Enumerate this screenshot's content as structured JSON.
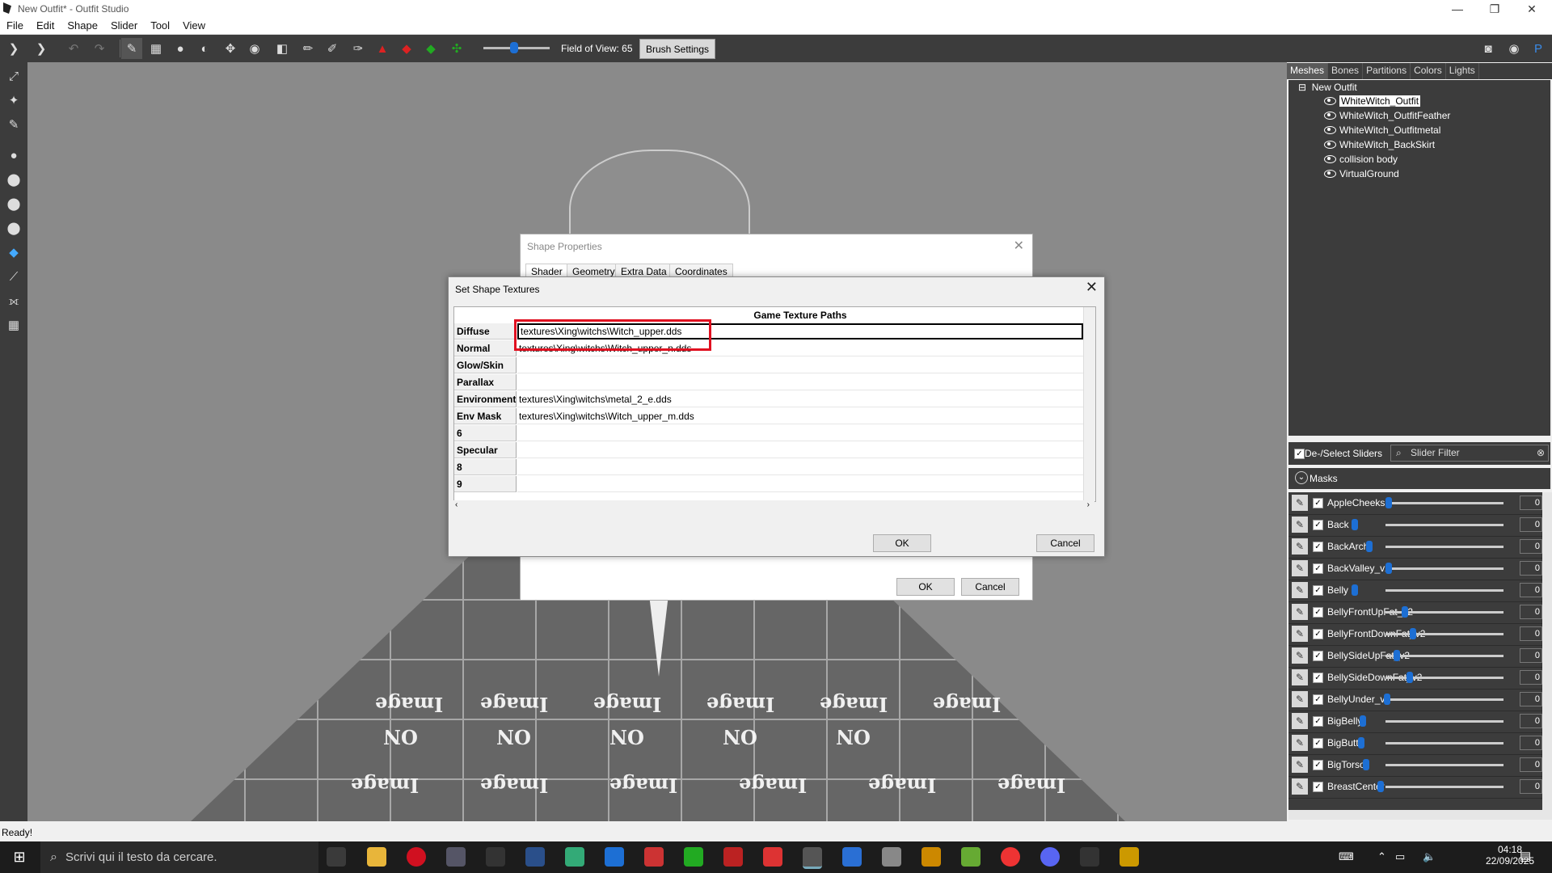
{
  "window": {
    "title": "New Outfit* - Outfit Studio",
    "minimize": "—",
    "maximize": "❐",
    "close": "✕"
  },
  "menu": [
    "File",
    "Edit",
    "Shape",
    "Slider",
    "Tool",
    "View"
  ],
  "toolbar": {
    "fov_label": "Field of View: 65",
    "brush_settings": "Brush Settings"
  },
  "right_panel": {
    "tabs": [
      "Meshes",
      "Bones",
      "Partitions",
      "Colors",
      "Lights"
    ],
    "tree_root": "New Outfit",
    "meshes": [
      "WhiteWitch_Outfit",
      "WhiteWitch_OutfitFeather",
      "WhiteWitch_Outfitmetal",
      "WhiteWitch_BackSkirt",
      "collision body",
      "VirtualGround"
    ],
    "selected_mesh": "WhiteWitch_Outfit",
    "deselect_label": "De-/Select Sliders",
    "slider_filter_placeholder": "Slider Filter",
    "masks_label": "Masks",
    "sliders": [
      {
        "name": "AppleCheeks",
        "pos": 0.0,
        "val": "0"
      },
      {
        "name": "Back",
        "pos": 0.0,
        "val": "0"
      },
      {
        "name": "BackArch",
        "pos": 0.0,
        "val": "0"
      },
      {
        "name": "BackValley_v2",
        "pos": 0.0,
        "val": "0"
      },
      {
        "name": "Belly",
        "pos": 0.0,
        "val": "0"
      },
      {
        "name": "BellyFrontUpFat_v2",
        "pos": 0.0,
        "val": "0"
      },
      {
        "name": "BellyFrontDownFat_v2",
        "pos": 0.0,
        "val": "0"
      },
      {
        "name": "BellySideUpFat_v2",
        "pos": 0.0,
        "val": "0"
      },
      {
        "name": "BellySideDownFat_v2",
        "pos": 0.0,
        "val": "0"
      },
      {
        "name": "BellyUnder_v2",
        "pos": 0.0,
        "val": "0"
      },
      {
        "name": "BigBelly",
        "pos": 0.0,
        "val": "0"
      },
      {
        "name": "BigButt",
        "pos": 0.0,
        "val": "0"
      },
      {
        "name": "BigTorso",
        "pos": 0.0,
        "val": "0"
      },
      {
        "name": "BreastCenter",
        "pos": 0.0,
        "val": "0"
      }
    ]
  },
  "status": "Ready!",
  "shape_properties": {
    "title": "Shape Properties",
    "tabs": [
      "Shader",
      "Geometry",
      "Extra Data",
      "Coordinates"
    ],
    "ok": "OK",
    "cancel": "Cancel"
  },
  "set_shape_textures": {
    "title": "Set Shape Textures",
    "column_header": "Game Texture Paths",
    "rows": [
      {
        "label": "Diffuse",
        "path": "textures\\Xing\\witchs\\Witch_upper.dds"
      },
      {
        "label": "Normal",
        "path": "textures\\Xing\\witchs\\Witch_upper_n.dds"
      },
      {
        "label": "Glow/Skin",
        "path": ""
      },
      {
        "label": "Parallax",
        "path": ""
      },
      {
        "label": "Environment",
        "path": "textures\\Xing\\witchs\\metal_2_e.dds"
      },
      {
        "label": "Env Mask",
        "path": "textures\\Xing\\witchs\\Witch_upper_m.dds"
      },
      {
        "label": "6",
        "path": ""
      },
      {
        "label": "Specular",
        "path": ""
      },
      {
        "label": "8",
        "path": ""
      },
      {
        "label": "9",
        "path": ""
      }
    ],
    "ok": "OK",
    "cancel": "Cancel"
  },
  "viewport_texture_text": [
    "Image",
    "ON"
  ],
  "taskbar": {
    "search_placeholder": "Scrivi qui il testo da cercare.",
    "time": "04:18",
    "date": "22/09/2025"
  }
}
